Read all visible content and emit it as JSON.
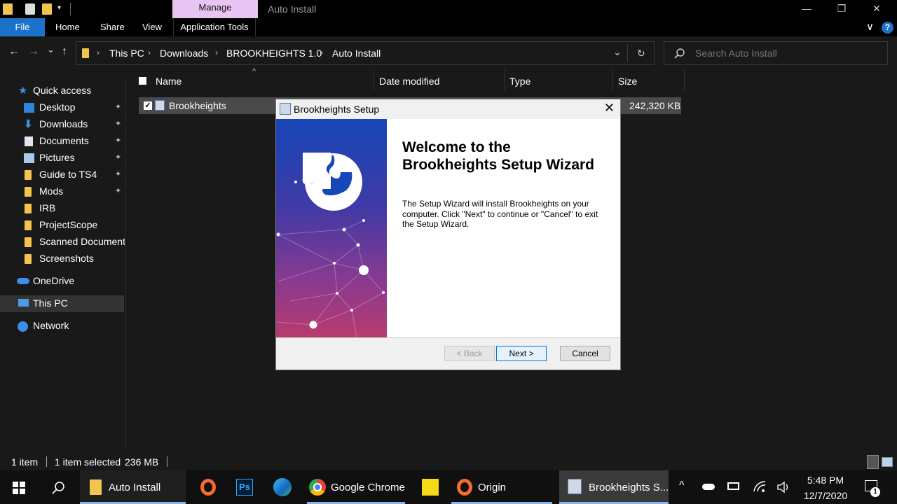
{
  "window": {
    "manage_tab": "Manage",
    "title": "Auto Install",
    "min_glyph": "—",
    "max_glyph": "❐",
    "close_glyph": "✕"
  },
  "ribbon": {
    "tabs": [
      "File",
      "Home",
      "Share",
      "View",
      "Application Tools"
    ],
    "expand_glyph": "∨",
    "help_glyph": "?"
  },
  "address": {
    "back_glyph": "←",
    "forward_glyph": "→",
    "recent_glyph": "⌄",
    "up_glyph": "↑",
    "crumbs": [
      "This PC",
      "Downloads",
      "BROOKHEIGHTS 1.0",
      "Auto Install"
    ],
    "sep_glyph": "›",
    "dropdown_glyph": "⌄",
    "refresh_glyph": "↻",
    "search_placeholder": "Search Auto Install"
  },
  "sidebar": {
    "quick_access": "Quick access",
    "pinned": [
      "Desktop",
      "Downloads",
      "Documents",
      "Pictures",
      "Guide to TS4",
      "Mods"
    ],
    "folders": [
      "IRB",
      "ProjectScope",
      "Scanned Documents",
      "Screenshots"
    ],
    "onedrive": "OneDrive",
    "this_pc": "This PC",
    "network": "Network",
    "pin_glyph": "📌"
  },
  "columns": {
    "name": "Name",
    "date": "Date modified",
    "type": "Type",
    "size": "Size",
    "sort_glyph": "^"
  },
  "file": {
    "name": "Brookheights",
    "size": "242,320 KB"
  },
  "status": {
    "count": "1 item",
    "selected": "1 item selected",
    "selected_size": "236 MB"
  },
  "dialog": {
    "title": "Brookheights Setup",
    "heading": "Welcome to the Brookheights Setup Wizard",
    "body": "The Setup Wizard will install Brookheights on your computer.  Click \"Next\" to continue or \"Cancel\" to exit the Setup Wizard.",
    "back": "< Back",
    "next": "Next >",
    "cancel": "Cancel",
    "close_glyph": "✕"
  },
  "taskbar": {
    "explorer": "Auto Install",
    "chrome": "Google Chrome",
    "origin": "Origin",
    "setup": "Brookheights S...",
    "ps_label": "Ps",
    "time": "5:48 PM",
    "date": "12/7/2020",
    "tray_glyph": "^",
    "notify_count": "1"
  },
  "colors": {
    "accent": "#1a73c9",
    "manage_tab": "#e8c4f2",
    "folder": "#f2c44d"
  }
}
